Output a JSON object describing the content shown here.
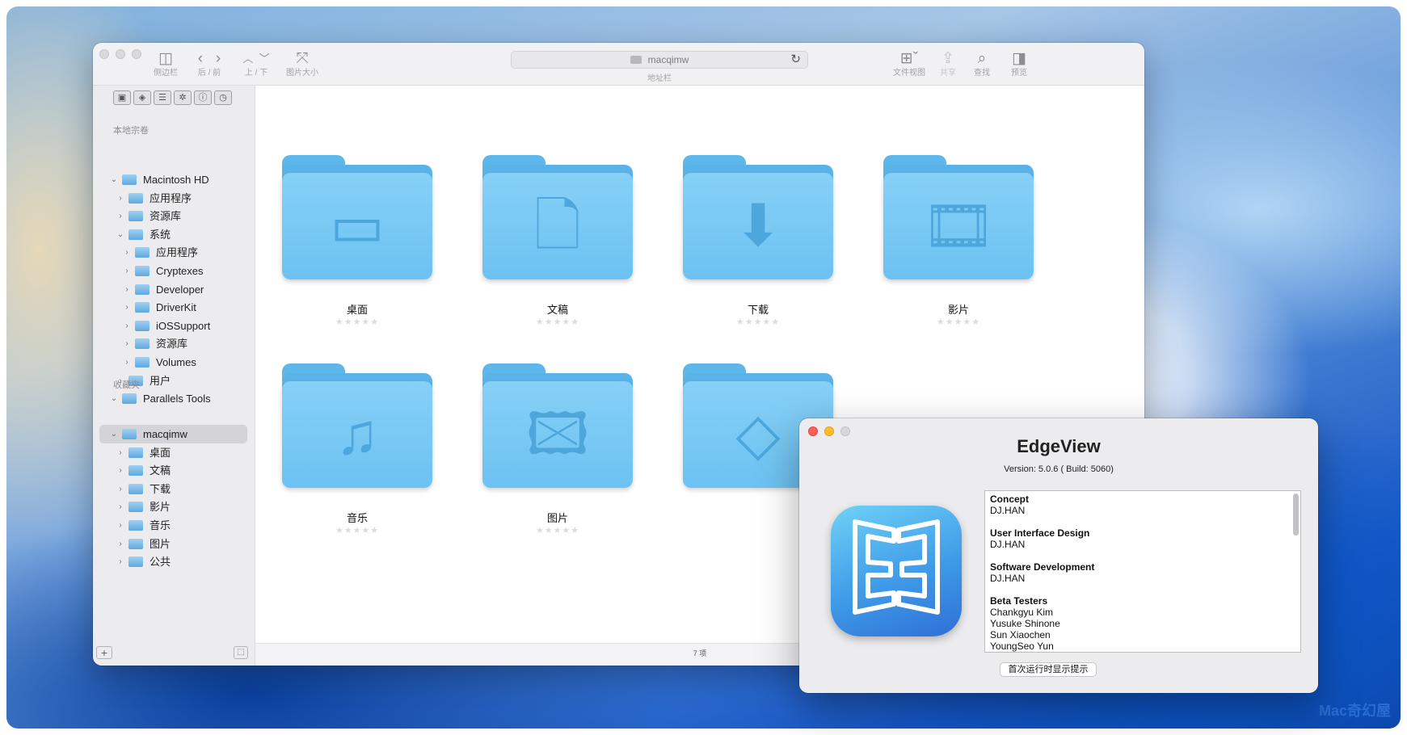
{
  "window": {
    "toolbar": {
      "sidebar": {
        "label": "侧边栏",
        "icon": "sidebar-icon"
      },
      "backforward": {
        "label": "后 / 前",
        "back_icon": "chevron-left-icon",
        "forward_icon": "chevron-right-icon"
      },
      "updown": {
        "label": "上 / 下",
        "up_icon": "chevron-up-icon",
        "down_icon": "chevron-down-icon"
      },
      "imagesize": {
        "label": "图片大小",
        "icon": "resize-icon"
      },
      "address": {
        "value": "macqimw",
        "label": "地址栏",
        "icon": "folder-icon",
        "reload_icon": "reload-icon"
      },
      "fileview": {
        "label": "文件视图",
        "icon": "grid-view-icon"
      },
      "share": {
        "label": "共享",
        "icon": "share-icon"
      },
      "search": {
        "label": "查找",
        "icon": "search-icon"
      },
      "preview": {
        "label": "预览",
        "icon": "preview-panel-icon"
      }
    },
    "sidebar": {
      "section_local": "本地宗卷",
      "section_fav": "收藏夹",
      "local_items": [
        {
          "label": "Macintosh HD",
          "level": 0,
          "expanded": true
        },
        {
          "label": "应用程序",
          "level": 1,
          "expanded": false
        },
        {
          "label": "资源库",
          "level": 1,
          "expanded": false
        },
        {
          "label": "系统",
          "level": 1,
          "expanded": true
        },
        {
          "label": "应用程序",
          "level": 2,
          "expanded": false
        },
        {
          "label": "Cryptexes",
          "level": 2,
          "expanded": false
        },
        {
          "label": "Developer",
          "level": 2,
          "expanded": false
        },
        {
          "label": "DriverKit",
          "level": 2,
          "expanded": false
        },
        {
          "label": "iOSSupport",
          "level": 2,
          "expanded": false
        },
        {
          "label": "资源库",
          "level": 2,
          "expanded": false
        },
        {
          "label": "Volumes",
          "level": 2,
          "expanded": false
        },
        {
          "label": "用户",
          "level": 1,
          "expanded": false
        },
        {
          "label": "Parallels Tools",
          "level": 0,
          "expanded": true
        }
      ],
      "fav_items": [
        {
          "label": "macqimw",
          "level": 0,
          "expanded": true,
          "selected": true
        },
        {
          "label": "桌面",
          "level": 1,
          "expanded": false
        },
        {
          "label": "文稿",
          "level": 1,
          "expanded": false
        },
        {
          "label": "下载",
          "level": 1,
          "expanded": false
        },
        {
          "label": "影片",
          "level": 1,
          "expanded": false
        },
        {
          "label": "音乐",
          "level": 1,
          "expanded": false
        },
        {
          "label": "图片",
          "level": 1,
          "expanded": false
        },
        {
          "label": "公共",
          "level": 1,
          "expanded": false
        }
      ],
      "add_button": "+"
    },
    "folders": [
      {
        "name": "桌面",
        "icon": "desktop-folder-icon",
        "glyph": "▭"
      },
      {
        "name": "文稿",
        "icon": "document-folder-icon",
        "glyph": "🗋"
      },
      {
        "name": "下载",
        "icon": "download-folder-icon",
        "glyph": "⬇"
      },
      {
        "name": "影片",
        "icon": "movies-folder-icon",
        "glyph": "🎞"
      },
      {
        "name": "音乐",
        "icon": "music-folder-icon",
        "glyph": "♫"
      },
      {
        "name": "图片",
        "icon": "pictures-folder-icon",
        "glyph": "🖾"
      },
      {
        "name": "",
        "icon": "public-folder-icon",
        "glyph": "◇"
      }
    ],
    "rating": "★★★★★",
    "status": "7 项"
  },
  "about": {
    "title": "EdgeView",
    "version": "Version: 5.0.6 ( Build: 5060)",
    "credits": [
      {
        "heading": "Concept",
        "names": [
          "DJ.HAN"
        ]
      },
      {
        "heading": "User Interface Design",
        "names": [
          "DJ.HAN"
        ]
      },
      {
        "heading": "Software Development",
        "names": [
          "DJ.HAN"
        ]
      },
      {
        "heading": "Beta Testers",
        "names": [
          "Chankgyu Kim",
          "Yusuke Shinone",
          "Sun Xiaochen",
          "YoungSeo Yun"
        ]
      }
    ],
    "show_on_launch": "首次运行时显示提示",
    "app_icon": "edgeview-app-icon"
  },
  "watermark": "Mac奇幻屋",
  "colors": {
    "folder": "#6cc2f1",
    "accent": "#2f73d8"
  }
}
